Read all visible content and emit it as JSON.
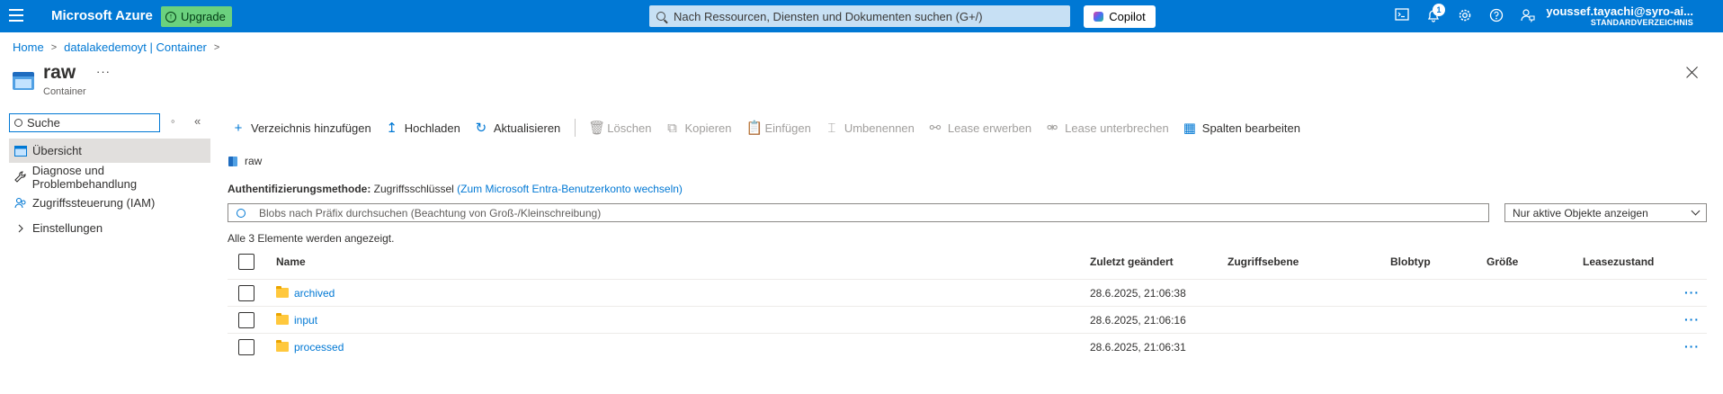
{
  "topbar": {
    "brand": "Microsoft Azure",
    "upgrade_label": "Upgrade",
    "search_placeholder": "Nach Ressourcen, Diensten und Dokumenten suchen (G+/)",
    "copilot_label": "Copilot",
    "notification_count": "1",
    "user_name": "youssef.tayachi@syro-ai...",
    "user_directory": "STANDARDVERZEICHNIS",
    "icons": [
      "cloud-shell-icon",
      "bell-icon",
      "gear-icon",
      "help-icon",
      "feedback-icon"
    ],
    "accent_color": "#0078d4"
  },
  "breadcrumb": {
    "items": [
      "Home",
      "datalakedemoyt | Container"
    ]
  },
  "resource": {
    "title": "raw",
    "subtitle": "Container",
    "more": "···"
  },
  "sidebar": {
    "search_placeholder": "Suche",
    "items": [
      {
        "label": "Übersicht",
        "active": true,
        "icon": "overview-icon"
      },
      {
        "label": "Diagnose und Problembehandlung",
        "icon": "wrench-icon"
      },
      {
        "label": "Zugriffssteuerung (IAM)",
        "icon": "people-icon"
      },
      {
        "label": "Einstellungen",
        "icon": "chevron-right-icon"
      }
    ]
  },
  "toolbar": {
    "add_directory": "Verzeichnis hinzufügen",
    "upload": "Hochladen",
    "refresh": "Aktualisieren",
    "delete": "Löschen",
    "copy": "Kopieren",
    "paste": "Einfügen",
    "rename": "Umbenennen",
    "acquire_lease": "Lease erwerben",
    "break_lease": "Lease unterbrechen",
    "edit_columns": "Spalten bearbeiten"
  },
  "path": "raw",
  "auth": {
    "label": "Authentifizierungsmethode:",
    "method": "Zugriffsschlüssel",
    "switch_link": "(Zum Microsoft Entra-Benutzerkonto wechseln)"
  },
  "blob_search_placeholder": "Blobs nach Präfix durchsuchen (Beachtung von Groß-/Kleinschreibung)",
  "filter_dropdown": "Nur aktive Objekte anzeigen",
  "count_text": "Alle 3 Elemente werden angezeigt.",
  "table": {
    "columns": [
      "Name",
      "Zuletzt geändert",
      "Zugriffsebene",
      "Blobtyp",
      "Größe",
      "Leasezustand"
    ],
    "rows": [
      {
        "name": "archived",
        "modified": "28.6.2025, 21:06:38",
        "tier": "",
        "type": "",
        "size": "",
        "lease": "",
        "more": "···"
      },
      {
        "name": "input",
        "modified": "28.6.2025, 21:06:16",
        "tier": "",
        "type": "",
        "size": "",
        "lease": "",
        "more": "···"
      },
      {
        "name": "processed",
        "modified": "28.6.2025, 21:06:31",
        "tier": "",
        "type": "",
        "size": "",
        "lease": "",
        "more": "···"
      }
    ]
  }
}
